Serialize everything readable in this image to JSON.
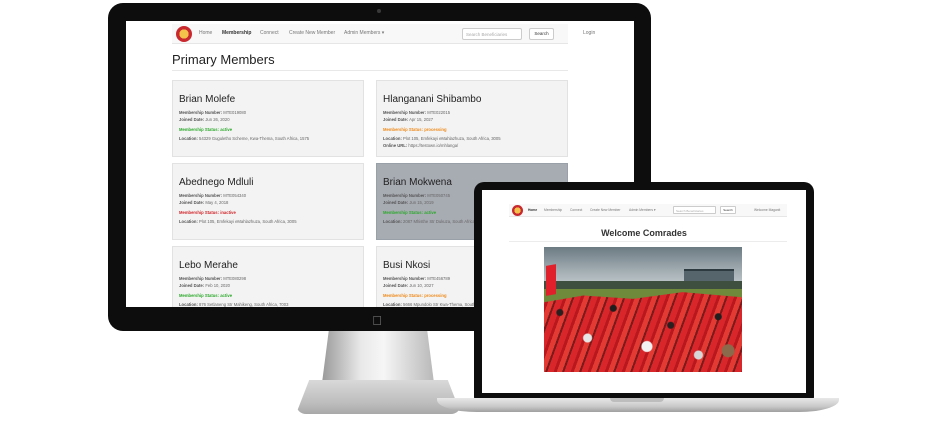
{
  "desktop": {
    "nav": {
      "items": [
        "Home",
        "Membership",
        "Connect",
        "Create New Member",
        "Admin Members ▾"
      ],
      "active": "Membership",
      "search_placeholder": "Search Beneficiaries",
      "search_button": "Search",
      "login": "Login"
    },
    "page_title": "Primary Members",
    "labels": {
      "number": "Membership Number:",
      "joined": "Joined Date:",
      "status": "Membership Status:",
      "location": "Location:",
      "url": "Online URL:"
    },
    "members": [
      {
        "name": "Brian Molefe",
        "number": "MTE019080",
        "joined": "Jun 26, 2020",
        "status": "active",
        "location": "54329 Guguletho Scheme, Kwa-Thema, South Africa, 1575"
      },
      {
        "name": "Hlanganani Shibambo",
        "number": "MTE022015",
        "joined": "Apr 15, 2027",
        "status": "processing",
        "location": "Plot 105, Emfekayi eMahlazhuza, South Africa, 3005",
        "url": "https://testown.io/mhlanga/"
      },
      {
        "name": "Abednego Mdluli",
        "number": "MTE054340",
        "joined": "May 4, 2018",
        "status": "inactive",
        "location": "Plot 105, Emfekayi eMahlazhuza, South Africa, 3005"
      },
      {
        "name": "Brian Mokwena",
        "number": "MTE050745",
        "joined": "Jun 15, 2019",
        "status": "active",
        "location": "2087 Mhisthe Str Dukuza, South Africa, 3101"
      },
      {
        "name": "Lebo Merahe",
        "number": "MTE080298",
        "joined": "Feb 10, 2020",
        "status": "active",
        "location": "876 Setlaneng Str Mahikeng, South Africa, 7003"
      },
      {
        "name": "Busi Nkosi",
        "number": "MTE456789",
        "joined": "Jun 10, 2027",
        "status": "processing",
        "location": "5666 Mpundolo Str Kwa-Thema, South Africa, 1575"
      }
    ]
  },
  "laptop": {
    "nav": {
      "items": [
        "Home",
        "Membership",
        "Connect",
        "Create New Member",
        "Admin Members ▾"
      ],
      "active": "Home",
      "search_placeholder": "Search Beneficiaries",
      "search_button": "Search",
      "welcome": "Welcome Maganit"
    },
    "page_title": "Welcome Comrades"
  },
  "colors": {
    "status_active": "#2eaa2e",
    "status_processing": "#ee8a1b",
    "status_inactive": "#d0262b",
    "card_bg": "#f3f3f3",
    "card_highlight_bg": "#a7abb2"
  },
  "icons": {
    "brand": "apple-logo-icon",
    "site_logo": "organisation-emblem-icon"
  }
}
